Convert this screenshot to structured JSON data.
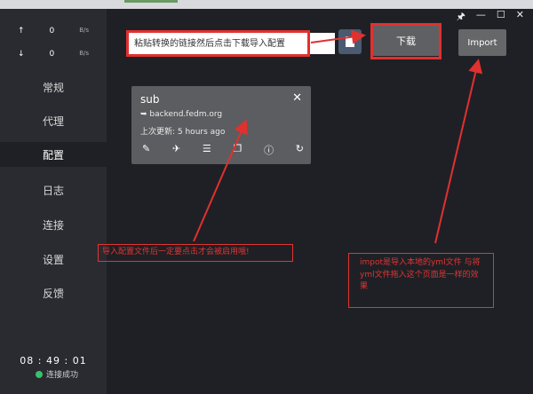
{
  "sidebar": {
    "upload": {
      "arrow": "↑",
      "value": "0",
      "unit": "B/s"
    },
    "download": {
      "arrow": "↓",
      "value": "0",
      "unit": "B/s"
    },
    "items": [
      {
        "label": "常规"
      },
      {
        "label": "代理"
      },
      {
        "label": "配置"
      },
      {
        "label": "日志"
      },
      {
        "label": "连接"
      },
      {
        "label": "设置"
      },
      {
        "label": "反馈"
      }
    ],
    "clock": "08 : 49 : 01",
    "status": "连接成功"
  },
  "window": {
    "pin": "🖈",
    "minimize": "—",
    "maximize": "☐",
    "close": "✕"
  },
  "toolbar": {
    "url_placeholder": "粘贴转换的链接然后点击下载导入配置",
    "download_label": "下载",
    "import_label": "Import"
  },
  "profile": {
    "name": "sub",
    "url": "➥ backend.fedm.org",
    "updated": "上次更新: 5 hours ago",
    "icons": [
      "edit-icon",
      "plane-icon",
      "list-icon",
      "copy-icon",
      "info-icon",
      "refresh-icon"
    ]
  },
  "annotations": {
    "note_enable": "导入配置文件后一定要点击才会被启用哦!",
    "note_import": "impot是导入本地的yml文件 与将yml文件拖入这个页面是一样的效果"
  },
  "colors": {
    "annotation": "#e0312f",
    "status_ok": "#36c36b"
  }
}
